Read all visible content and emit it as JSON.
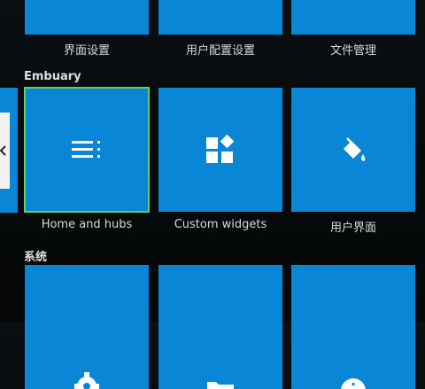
{
  "rows": {
    "top": {
      "labels": [
        "界面设置",
        "用户配置设置",
        "文件管理"
      ]
    },
    "embuary": {
      "title": "Embuary",
      "tiles": [
        {
          "label": "Home and hubs",
          "icon": "list-lines-icon",
          "focused": true
        },
        {
          "label": "Custom widgets",
          "icon": "widgets-icon"
        },
        {
          "label": "用户界面",
          "icon": "paint-bucket-icon"
        }
      ]
    },
    "system": {
      "title": "系统",
      "tiles": [
        {
          "icon": "gear-icon"
        },
        {
          "icon": "folder-icon"
        },
        {
          "icon": "info-icon"
        }
      ]
    }
  },
  "colors": {
    "tile_blue": "#0a86d6",
    "focus_green": "#5fd35a"
  }
}
